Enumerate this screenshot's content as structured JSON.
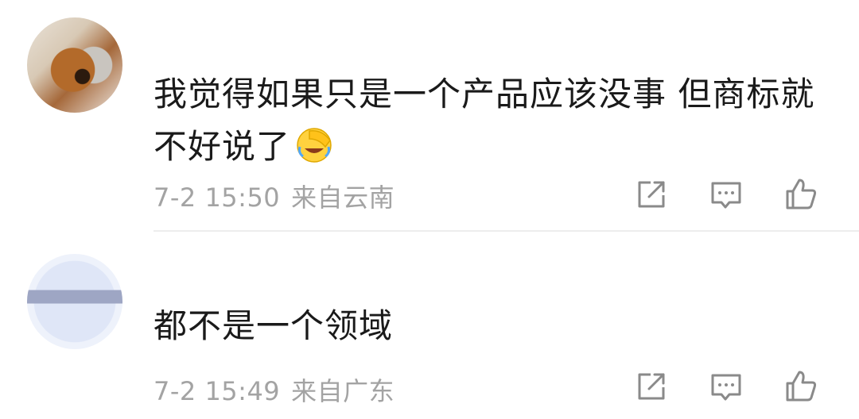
{
  "comments": [
    {
      "text": "我觉得如果只是一个产品应该没事 但商标就不好说了",
      "time": "7-2 15:50",
      "location": "来自云南"
    },
    {
      "text": "都不是一个领域",
      "time": "7-2 15:49",
      "location": "来自广东"
    }
  ],
  "icons": {
    "share": "share-icon",
    "reply": "comment-icon",
    "like": "thumbs-up-icon",
    "emoji": "facepalm-laugh-emoji"
  },
  "colors": {
    "text": "#1a1a1a",
    "meta": "#a3a3a3",
    "icon": "#8a8a8a",
    "divider": "#ededed"
  }
}
